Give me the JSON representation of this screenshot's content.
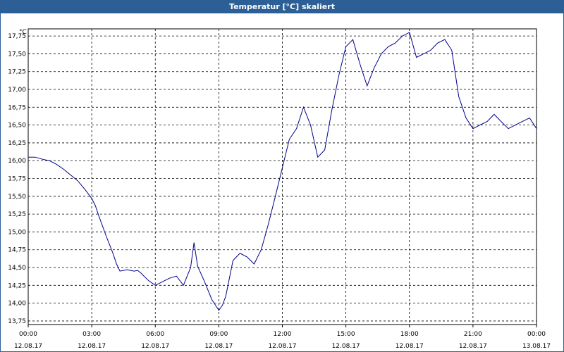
{
  "window": {
    "title": "Temperatur [°C] skaliert"
  },
  "chart_data": {
    "type": "line",
    "title": "Temperatur [°C] skaliert",
    "ylabel": "°C",
    "xlabel": "",
    "ylim": [
      13.75,
      17.8
    ],
    "xlim": [
      0,
      24
    ],
    "grid": true,
    "y_ticks": [
      "13,75",
      "14,00",
      "14,25",
      "14,50",
      "14,75",
      "15,00",
      "15,25",
      "15,50",
      "15,75",
      "16,00",
      "16,25",
      "16,50",
      "16,75",
      "17,00",
      "17,25",
      "17,50",
      "17,75"
    ],
    "x_ticks": [
      {
        "time": "00:00",
        "date": "12.08.17"
      },
      {
        "time": "03:00",
        "date": "12.08.17"
      },
      {
        "time": "06:00",
        "date": "12.08.17"
      },
      {
        "time": "09:00",
        "date": "12.08.17"
      },
      {
        "time": "12:00",
        "date": "12.08.17"
      },
      {
        "time": "15:00",
        "date": "12.08.17"
      },
      {
        "time": "18:00",
        "date": "12.08.17"
      },
      {
        "time": "21:00",
        "date": "12.08.17"
      },
      {
        "time": "00:00",
        "date": "13.08.17"
      }
    ],
    "line_color": "#00008b",
    "series": [
      {
        "x": [
          0,
          0.33,
          0.67,
          1.0,
          1.33,
          1.67,
          2.0,
          2.33,
          2.67,
          3.0,
          3.17,
          3.33,
          3.67,
          4.0,
          4.17,
          4.33,
          4.67,
          5.0,
          5.17,
          5.33,
          5.67,
          6.0,
          6.33,
          6.67,
          7.0,
          7.33,
          7.67,
          7.83,
          8.0,
          8.33,
          8.67,
          9.0,
          9.17,
          9.33,
          9.67,
          10.0,
          10.33,
          10.67,
          11.0,
          11.33,
          11.67,
          12.0,
          12.33,
          12.67,
          13.0,
          13.33,
          13.67,
          14.0,
          14.33,
          14.67,
          15.0,
          15.33,
          15.67,
          16.0,
          16.33,
          16.67,
          17.0,
          17.33,
          17.67,
          18.0,
          18.33,
          18.67,
          19.0,
          19.33,
          19.67,
          20.0,
          20.33,
          20.67,
          21.0,
          21.33,
          21.67,
          22.0,
          22.33,
          22.67,
          23.0,
          23.33,
          23.67,
          24.0
        ],
        "y": [
          16.05,
          16.05,
          16.02,
          16.0,
          15.95,
          15.88,
          15.8,
          15.72,
          15.6,
          15.47,
          15.37,
          15.23,
          14.95,
          14.7,
          14.55,
          14.45,
          14.47,
          14.45,
          14.46,
          14.42,
          14.32,
          14.25,
          14.3,
          14.35,
          14.38,
          14.25,
          14.5,
          14.85,
          14.52,
          14.3,
          14.05,
          13.9,
          13.97,
          14.1,
          14.6,
          14.7,
          14.65,
          14.55,
          14.75,
          15.1,
          15.5,
          15.9,
          16.3,
          16.45,
          16.75,
          16.5,
          16.05,
          16.15,
          16.7,
          17.2,
          17.6,
          17.7,
          17.35,
          17.05,
          17.3,
          17.5,
          17.6,
          17.65,
          17.75,
          17.8,
          17.45,
          17.5,
          17.55,
          17.65,
          17.7,
          17.55,
          16.9,
          16.6,
          16.45,
          16.5,
          16.55,
          16.65,
          16.55,
          16.45,
          16.5,
          16.55,
          16.6,
          16.45
        ]
      }
    ]
  }
}
